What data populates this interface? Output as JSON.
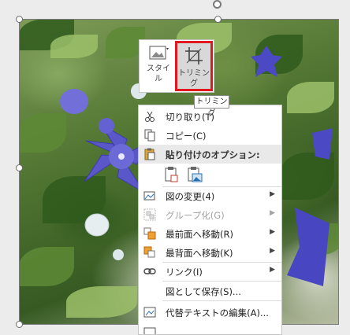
{
  "mini_toolbar": {
    "style_label_line1": "スタイ",
    "style_label_line2": "ル",
    "crop_label": "トリミング"
  },
  "tooltip": {
    "text": "トリミング"
  },
  "context_menu": {
    "cut": "切り取り(T)",
    "copy": "コピー(C)",
    "paste_header": "貼り付けのオプション:",
    "change_picture": "図の変更(4)",
    "group": "グループ化(G)",
    "bring_front": "最前面へ移動(R)",
    "send_back": "最背面へ移動(K)",
    "link": "リンク(I)",
    "save_as_picture": "図として保存(S)...",
    "alt_text": "代替テキストの編集(A)..."
  },
  "colors": {
    "crop_highlight": "#e0191f",
    "flower": "#5a58c9"
  }
}
